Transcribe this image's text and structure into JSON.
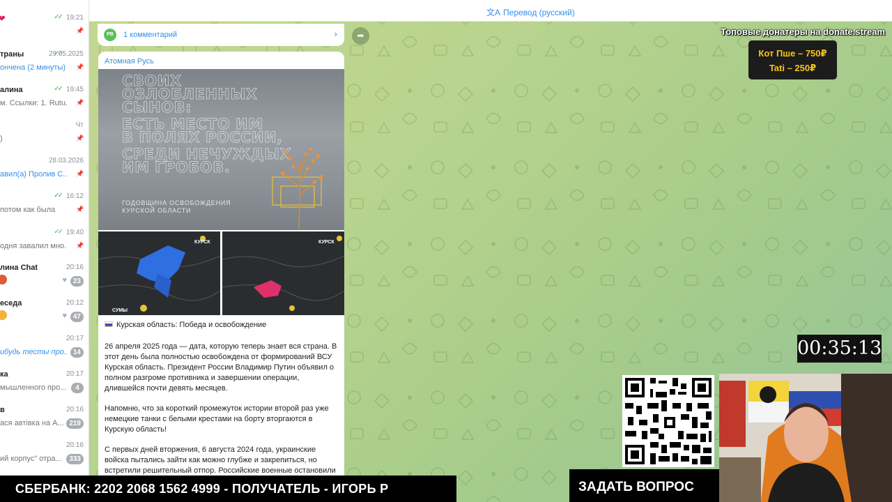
{
  "chat_list": [
    {
      "name": "",
      "time": "19:21",
      "preview": "",
      "read": true,
      "pinned": true,
      "heart_emoji": true
    },
    {
      "name": "траны",
      "time": "29.05.2025",
      "preview": "ончена (2 минуты)",
      "preview_style": "blue",
      "read": true,
      "pinned": true
    },
    {
      "name": "алина",
      "time": "19:45",
      "preview": "м.  Ссылки: 1. Rutu...",
      "read": true,
      "pinned": true
    },
    {
      "name": "",
      "time": "Чт",
      "preview": ")",
      "pinned": true
    },
    {
      "name": "",
      "time": "28.03.2026",
      "preview": "авил(а) Пролив С...",
      "preview_style": "blue",
      "pinned": true
    },
    {
      "name": "",
      "time": "16:12",
      "preview": "потом как была",
      "read": true,
      "pinned": true
    },
    {
      "name": "",
      "time": "19:40",
      "preview": "одня завалил мно...",
      "read": true,
      "pinned": true
    },
    {
      "name": "лина Chat",
      "time": "20:16",
      "preview": "",
      "badge": "23",
      "heart": true,
      "emoji": "red"
    },
    {
      "name": "еседа",
      "time": "20:12",
      "preview": "",
      "badge": "47",
      "heart": true,
      "emoji": "yellow"
    },
    {
      "name": "",
      "time": "20:17",
      "preview": "ибудь тесты про...",
      "preview_style": "blue-italic",
      "badge": "14"
    },
    {
      "name": "ка",
      "time": "20:17",
      "preview": "мышленного про...",
      "badge": "4"
    },
    {
      "name": "в",
      "time": "20:16",
      "preview": "ася автівка на А...",
      "badge": "219"
    },
    {
      "name": "",
      "time": "20:16",
      "preview": "ий корпус\" отра...",
      "badge": "333"
    }
  ],
  "topbar": {
    "translate_label": "Перевод (русский)"
  },
  "comment_bar": {
    "avatar_initials": "РВ",
    "label": "1 комментарий"
  },
  "post": {
    "channel": "Атомная Русь",
    "image_headline": [
      "СВОИХ",
      "ОЗЛОБЛЕННЫХ",
      "СЫНОВ:",
      "ЕСТЬ МЕСТО ИМ",
      "В ПОЛЯХ РОССИИ,",
      "СРЕДИ НЕЧУЖДЫХ",
      "ИМ ГРОБОВ."
    ],
    "image_caption": [
      "ГОДОВЩИНА ОСВОБОЖДЕНИЯ",
      "КУРСКОЙ ОБЛАСТИ"
    ],
    "map_labels": {
      "city_top": "КУРСК",
      "city_bottom": "СУМЫ"
    },
    "title": "Курская область: Победа и освобождение",
    "paragraphs": [
      "26 апреля 2025 года — дата, которую теперь знает вся страна. В этот день была полностью освобождена от формирований ВСУ Курская область. Президент России Владимир Путин объявил о полном разгроме противника и завершении операции, длившейся почти девять месяцев.",
      "Напомню, что за короткий промежуток истории второй раз уже немецкие танки с белыми крестами на борту вторгаются в Курскую область!",
      "С первых дней вторжения, 6 августа 2024 года, украинские войска пытались зайти как можно глубже и закрепиться, но встретили решительный отпор. Российские военные остановили"
    ]
  },
  "overlays": {
    "donors_title": "Топовые донатеры на donate.stream",
    "donors": [
      "Кот Пше – 750₽",
      "Tati – 250₽"
    ],
    "timer": "00:35:13",
    "bank_banner": "СБЕРБАНК: 2202 2068 1562 4999 - ПОЛУЧАТЕЛЬ - ИГОРЬ Р",
    "ask_banner": "ЗАДАТЬ ВОПРОС"
  },
  "colors": {
    "accent": "#3390ec",
    "read_check": "#4fae4e",
    "donor_gold": "#f5c518",
    "chat_bg": "#b8d48e"
  }
}
